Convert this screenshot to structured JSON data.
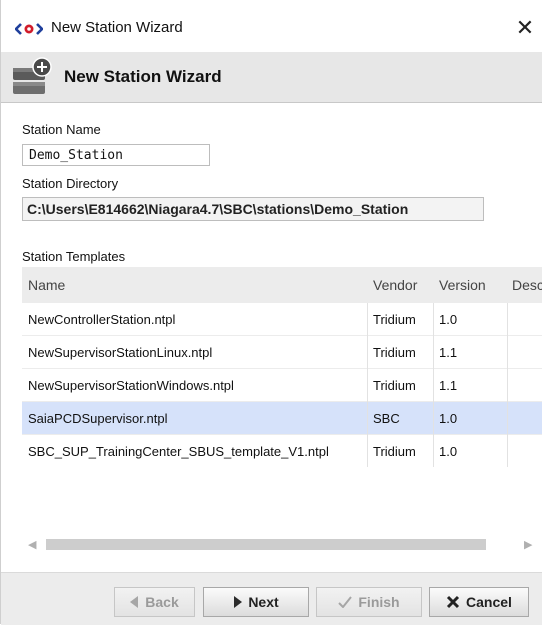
{
  "window": {
    "title": "New Station Wizard",
    "close_glyph": "✕",
    "app_icon": "niagara-logo-icon"
  },
  "banner": {
    "heading": "New Station Wizard",
    "icon": "new-station-database-icon"
  },
  "form": {
    "station_name_label": "Station Name",
    "station_name_value": "Demo_Station",
    "station_directory_label": "Station Directory",
    "station_directory_value": "C:\\Users\\E814662\\Niagara4.7\\SBC\\stations\\Demo_Station"
  },
  "templates": {
    "label": "Station Templates",
    "columns": [
      "Name",
      "Vendor",
      "Version",
      "Desc"
    ],
    "rows": [
      {
        "name": "NewControllerStation.ntpl",
        "vendor": "Tridium",
        "version": "1.0",
        "selected": false
      },
      {
        "name": "NewSupervisorStationLinux.ntpl",
        "vendor": "Tridium",
        "version": "1.1",
        "selected": false
      },
      {
        "name": "NewSupervisorStationWindows.ntpl",
        "vendor": "Tridium",
        "version": "1.1",
        "selected": false
      },
      {
        "name": "SaiaPCDSupervisor.ntpl",
        "vendor": "SBC",
        "version": "1.0",
        "selected": true
      },
      {
        "name": "SBC_SUP_TrainingCenter_SBUS_template_V1.ntpl",
        "vendor": "Tridium",
        "version": "1.0",
        "selected": false
      }
    ]
  },
  "buttons": {
    "back": "Back",
    "next": "Next",
    "finish": "Finish",
    "cancel": "Cancel"
  },
  "colors": {
    "selected_row": "#d6e2fa",
    "banner_bg": "#e7e7e7",
    "button_bar_bg": "#ececec"
  }
}
